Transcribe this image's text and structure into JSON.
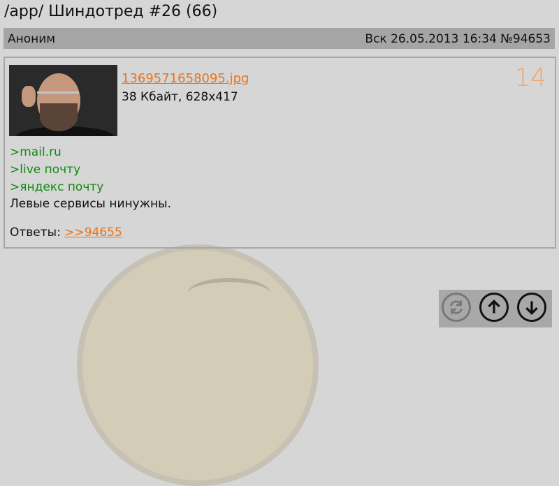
{
  "header": {
    "title": "/app/ Шиндотред #26 (66)"
  },
  "post": {
    "author": "Аноним",
    "meta": "Вск 26.05.2013 16:34 №94653",
    "file_name": "1369571658095.jpg",
    "file_info": "38 Кбайт, 628x417",
    "index_number": "14",
    "quotes": [
      ">mail.ru",
      ">live почту",
      ">яндекс почту"
    ],
    "text": "Левые сервисы нинужны.",
    "replies_label": "Ответы:",
    "reply_link": ">>94655"
  },
  "toolbar": {
    "refresh_icon": "refresh-icon",
    "up_icon": "arrow-up-icon",
    "down_icon": "arrow-down-icon"
  },
  "colors": {
    "link": "#e8741e",
    "quote": "#138a13",
    "number": "#f0a76a"
  }
}
